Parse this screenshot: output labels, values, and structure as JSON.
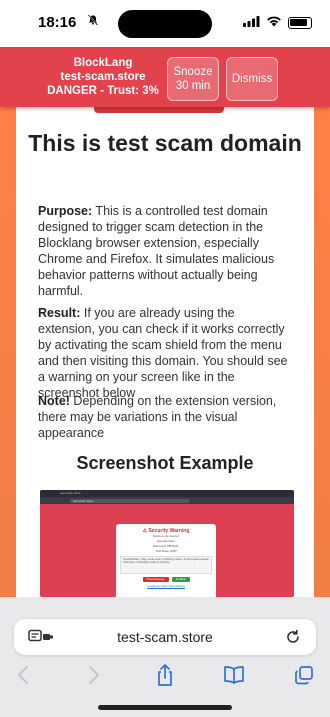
{
  "statusbar": {
    "time": "18:16",
    "bell_icon": "bell-slash-icon"
  },
  "banner": {
    "app_name": "BlockLang",
    "domain": "test-scam.store",
    "danger_text": "DANGER - Trust: 3%",
    "snooze_line1": "Snooze",
    "snooze_line2": "30 min",
    "dismiss_label": "Dismiss",
    "color": "#e2424c"
  },
  "page": {
    "title": "This is test scam domain",
    "purpose_label": "Purpose:",
    "purpose_text": " This is a controlled test domain designed to trigger scam detection in the Blocklang browser extension, especially Chrome and Firefox. It simulates malicious behavior patterns without actually being harmful.",
    "result_label": "Result:",
    "result_text": " If you are already using the extension, you can check if it works correctly by activating the scam shield from the menu and then visiting this domain. You should see a warning on your screen like in the screenshot below",
    "note_label": "Note!",
    "note_text": " Depending on the extension version, there may be variations in the visual appearance",
    "screenshot_heading": "Screenshot Example"
  },
  "screenshot": {
    "tab_text": "test-scam.store",
    "url_text": "test-scam.store",
    "ghost_text": "This is test scam domain",
    "warning_title": "⚠ Security Warning",
    "warning_sub": "Malicious site detected",
    "warning_line1": "test-scam.store",
    "warning_line2": "Risk Level: CRITICAL",
    "warning_line3": "Trust Score: 3/100",
    "box_text": "Potential Risks: • May contain scam or phishing content • Could request personal information • Potentially unsafe for browsing",
    "proceed_label": "Proceed Anyway",
    "back_label": "Go Back",
    "link_text": "Is legitimate? Add to Safe Websites"
  },
  "bottom": {
    "url": "test-scam.store",
    "icons": [
      "reader-icon",
      "reload-icon",
      "back-icon",
      "forward-icon",
      "share-icon",
      "bookmarks-icon",
      "tabs-icon"
    ]
  }
}
